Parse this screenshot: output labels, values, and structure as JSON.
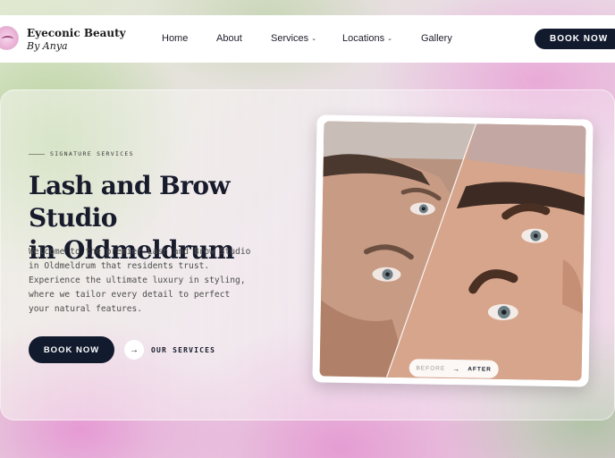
{
  "header": {
    "brand_name": "Eyeconic Beauty",
    "brand_tagline": "By Anya",
    "nav": [
      {
        "label": "Home"
      },
      {
        "label": "About"
      },
      {
        "label": "Services"
      },
      {
        "label": "Locations"
      },
      {
        "label": "Gallery"
      }
    ],
    "book_label": "BOOK NOW"
  },
  "hero": {
    "eyebrow": "SIGNATURE SERVICES",
    "title_line1": "Lash and Brow Studio",
    "title_line2": "in Oldmeldrum",
    "description": "Welcome to the premier Lash and Brow Studio in Oldmeldrum that residents trust. Experience the ultimate luxury in styling, where we tailor every detail to perfect your natural features.",
    "book_label": "BOOK NOW",
    "services_label": "OUR SERVICES"
  },
  "comparison": {
    "before_label": "BEFORE",
    "after_label": "AFTER"
  },
  "icons": {
    "services_arrow": "arrow-right-icon",
    "comparison_arrow": "arrow-right-icon",
    "dropdown": "chevron-down-icon"
  },
  "colors": {
    "primary_dark": "#121a2e",
    "title_text": "#171b2c"
  }
}
